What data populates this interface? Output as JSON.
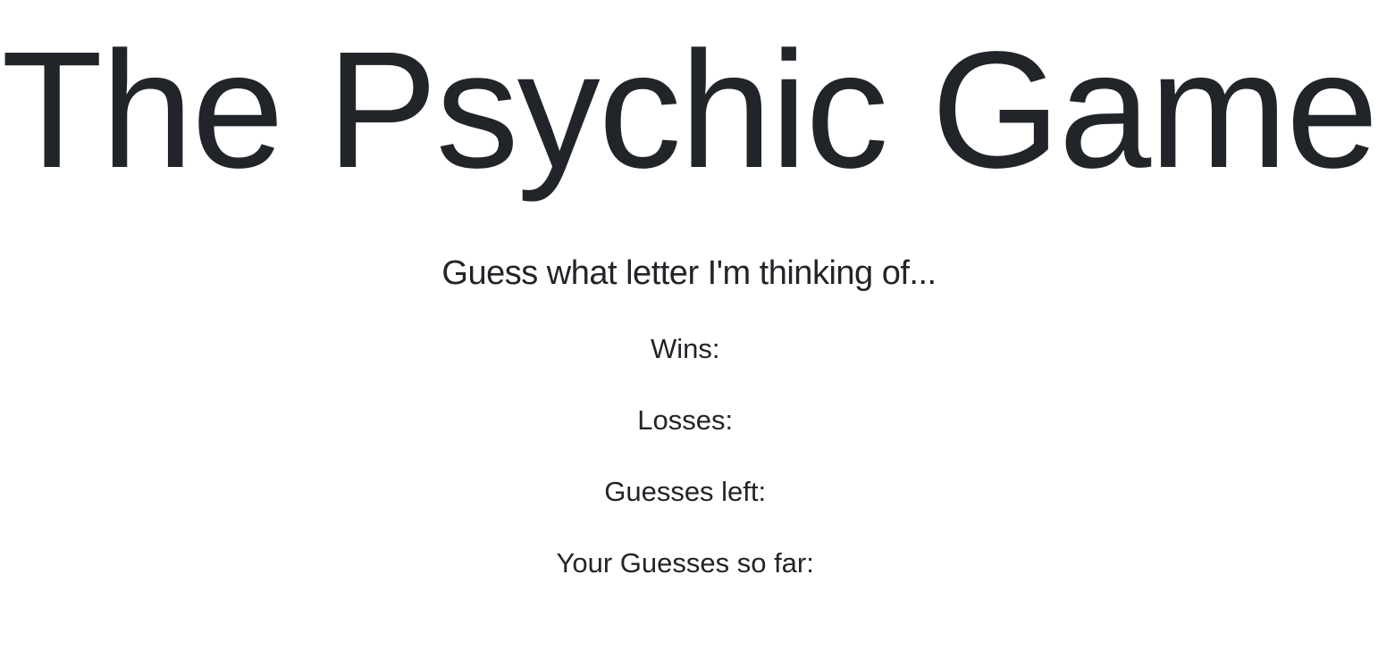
{
  "header": {
    "title": "The Psychic Game"
  },
  "main": {
    "subtitle": "Guess what letter I'm thinking of...",
    "stats": {
      "wins_label": "Wins:",
      "wins_value": "",
      "losses_label": "Losses:",
      "losses_value": "",
      "guesses_left_label": "Guesses left:",
      "guesses_left_value": "",
      "guesses_so_far_label": "Your Guesses so far:",
      "guesses_so_far_value": ""
    }
  },
  "colors": {
    "text": "#212529",
    "background": "#ffffff"
  }
}
